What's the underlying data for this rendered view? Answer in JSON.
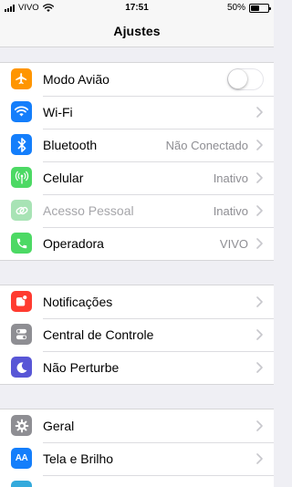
{
  "status_bar": {
    "carrier": "VIVO",
    "time": "17:51",
    "battery_percent": "50%",
    "battery_level": 0.5
  },
  "nav": {
    "title": "Ajustes"
  },
  "colors": {
    "airplane": "#ff9500",
    "wifi": "#147efb",
    "bluetooth": "#147efb",
    "cellular": "#4cd964",
    "hotspot": "#a8e3b5",
    "carrier": "#4cd964",
    "notifications": "#ff3b30",
    "control_center": "#8e8e93",
    "do_not_disturb": "#5856d6",
    "general": "#8e8e93",
    "display": "#147efb"
  },
  "groups": [
    {
      "rows": [
        {
          "icon": "airplane-icon",
          "label": "Modo Avião",
          "toggle": false
        },
        {
          "icon": "wifi-icon",
          "label": "Wi-Fi",
          "value": ""
        },
        {
          "icon": "bluetooth-icon",
          "label": "Bluetooth",
          "value": "Não Conectado"
        },
        {
          "icon": "antenna-icon",
          "label": "Celular",
          "value": "Inativo"
        },
        {
          "icon": "link-icon",
          "label": "Acesso Pessoal",
          "value": "Inativo",
          "dimmed": true
        },
        {
          "icon": "phone-icon",
          "label": "Operadora",
          "value": "VIVO"
        }
      ]
    },
    {
      "rows": [
        {
          "icon": "notifications-icon",
          "label": "Notificações"
        },
        {
          "icon": "switches-icon",
          "label": "Central de Controle"
        },
        {
          "icon": "moon-icon",
          "label": "Não Perturbe"
        }
      ]
    },
    {
      "rows": [
        {
          "icon": "gear-icon",
          "label": "Geral"
        },
        {
          "icon": "text-size-icon",
          "label": "Tela e Brilho",
          "icon_text": "AA"
        }
      ]
    }
  ]
}
